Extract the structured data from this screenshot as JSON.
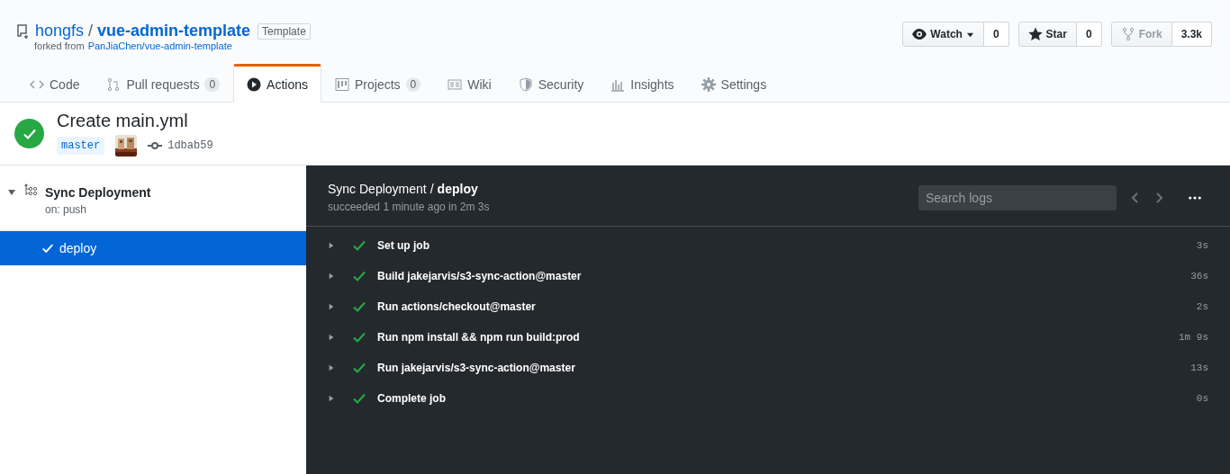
{
  "repo": {
    "owner": "hongfs",
    "separator": "/",
    "name": "vue-admin-template",
    "badge": "Template",
    "forked_prefix": "forked from",
    "forked_link": "PanJiaChen/vue-admin-template"
  },
  "actions": [
    {
      "kind": "watch",
      "label": "Watch",
      "count": "0",
      "disabled": false
    },
    {
      "kind": "star",
      "label": "Star",
      "count": "0",
      "disabled": false
    },
    {
      "kind": "fork",
      "label": "Fork",
      "count": "3.3k",
      "disabled": true
    }
  ],
  "tabs": [
    {
      "kind": "code",
      "label": "Code",
      "selected": false
    },
    {
      "kind": "pr",
      "label": "Pull requests",
      "counter": "0",
      "selected": false
    },
    {
      "kind": "actions",
      "label": "Actions",
      "selected": true
    },
    {
      "kind": "projects",
      "label": "Projects",
      "counter": "0",
      "selected": false
    },
    {
      "kind": "wiki",
      "label": "Wiki",
      "selected": false
    },
    {
      "kind": "security",
      "label": "Security",
      "selected": false
    },
    {
      "kind": "insights",
      "label": "Insights",
      "selected": false
    },
    {
      "kind": "settings",
      "label": "Settings",
      "selected": false
    }
  ],
  "run": {
    "title": "Create main.yml",
    "branch": "master",
    "commit": "1dbab59",
    "success": true
  },
  "sidebar": {
    "workflow": "Sync Deployment",
    "trigger": "on: push",
    "expanded": true,
    "jobs": [
      {
        "label": "deploy",
        "selected": true
      }
    ]
  },
  "log": {
    "workflow": "Sync Deployment",
    "separator": "/",
    "job": "deploy",
    "status": "succeeded 1 minute ago in 2m 3s",
    "search": {
      "placeholder": "Search logs"
    },
    "steps": [
      {
        "label": "Set up job",
        "duration": "3s",
        "success": true
      },
      {
        "label": "Build jakejarvis/s3-sync-action@master",
        "duration": "36s",
        "success": true
      },
      {
        "label": "Run actions/checkout@master",
        "duration": "2s",
        "success": true
      },
      {
        "label": "Run npm install && npm run build:prod",
        "duration": "1m 9s",
        "success": true
      },
      {
        "label": "Run jakejarvis/s3-sync-action@master",
        "duration": "13s",
        "success": true
      },
      {
        "label": "Complete job",
        "duration": "0s",
        "success": true
      }
    ]
  }
}
